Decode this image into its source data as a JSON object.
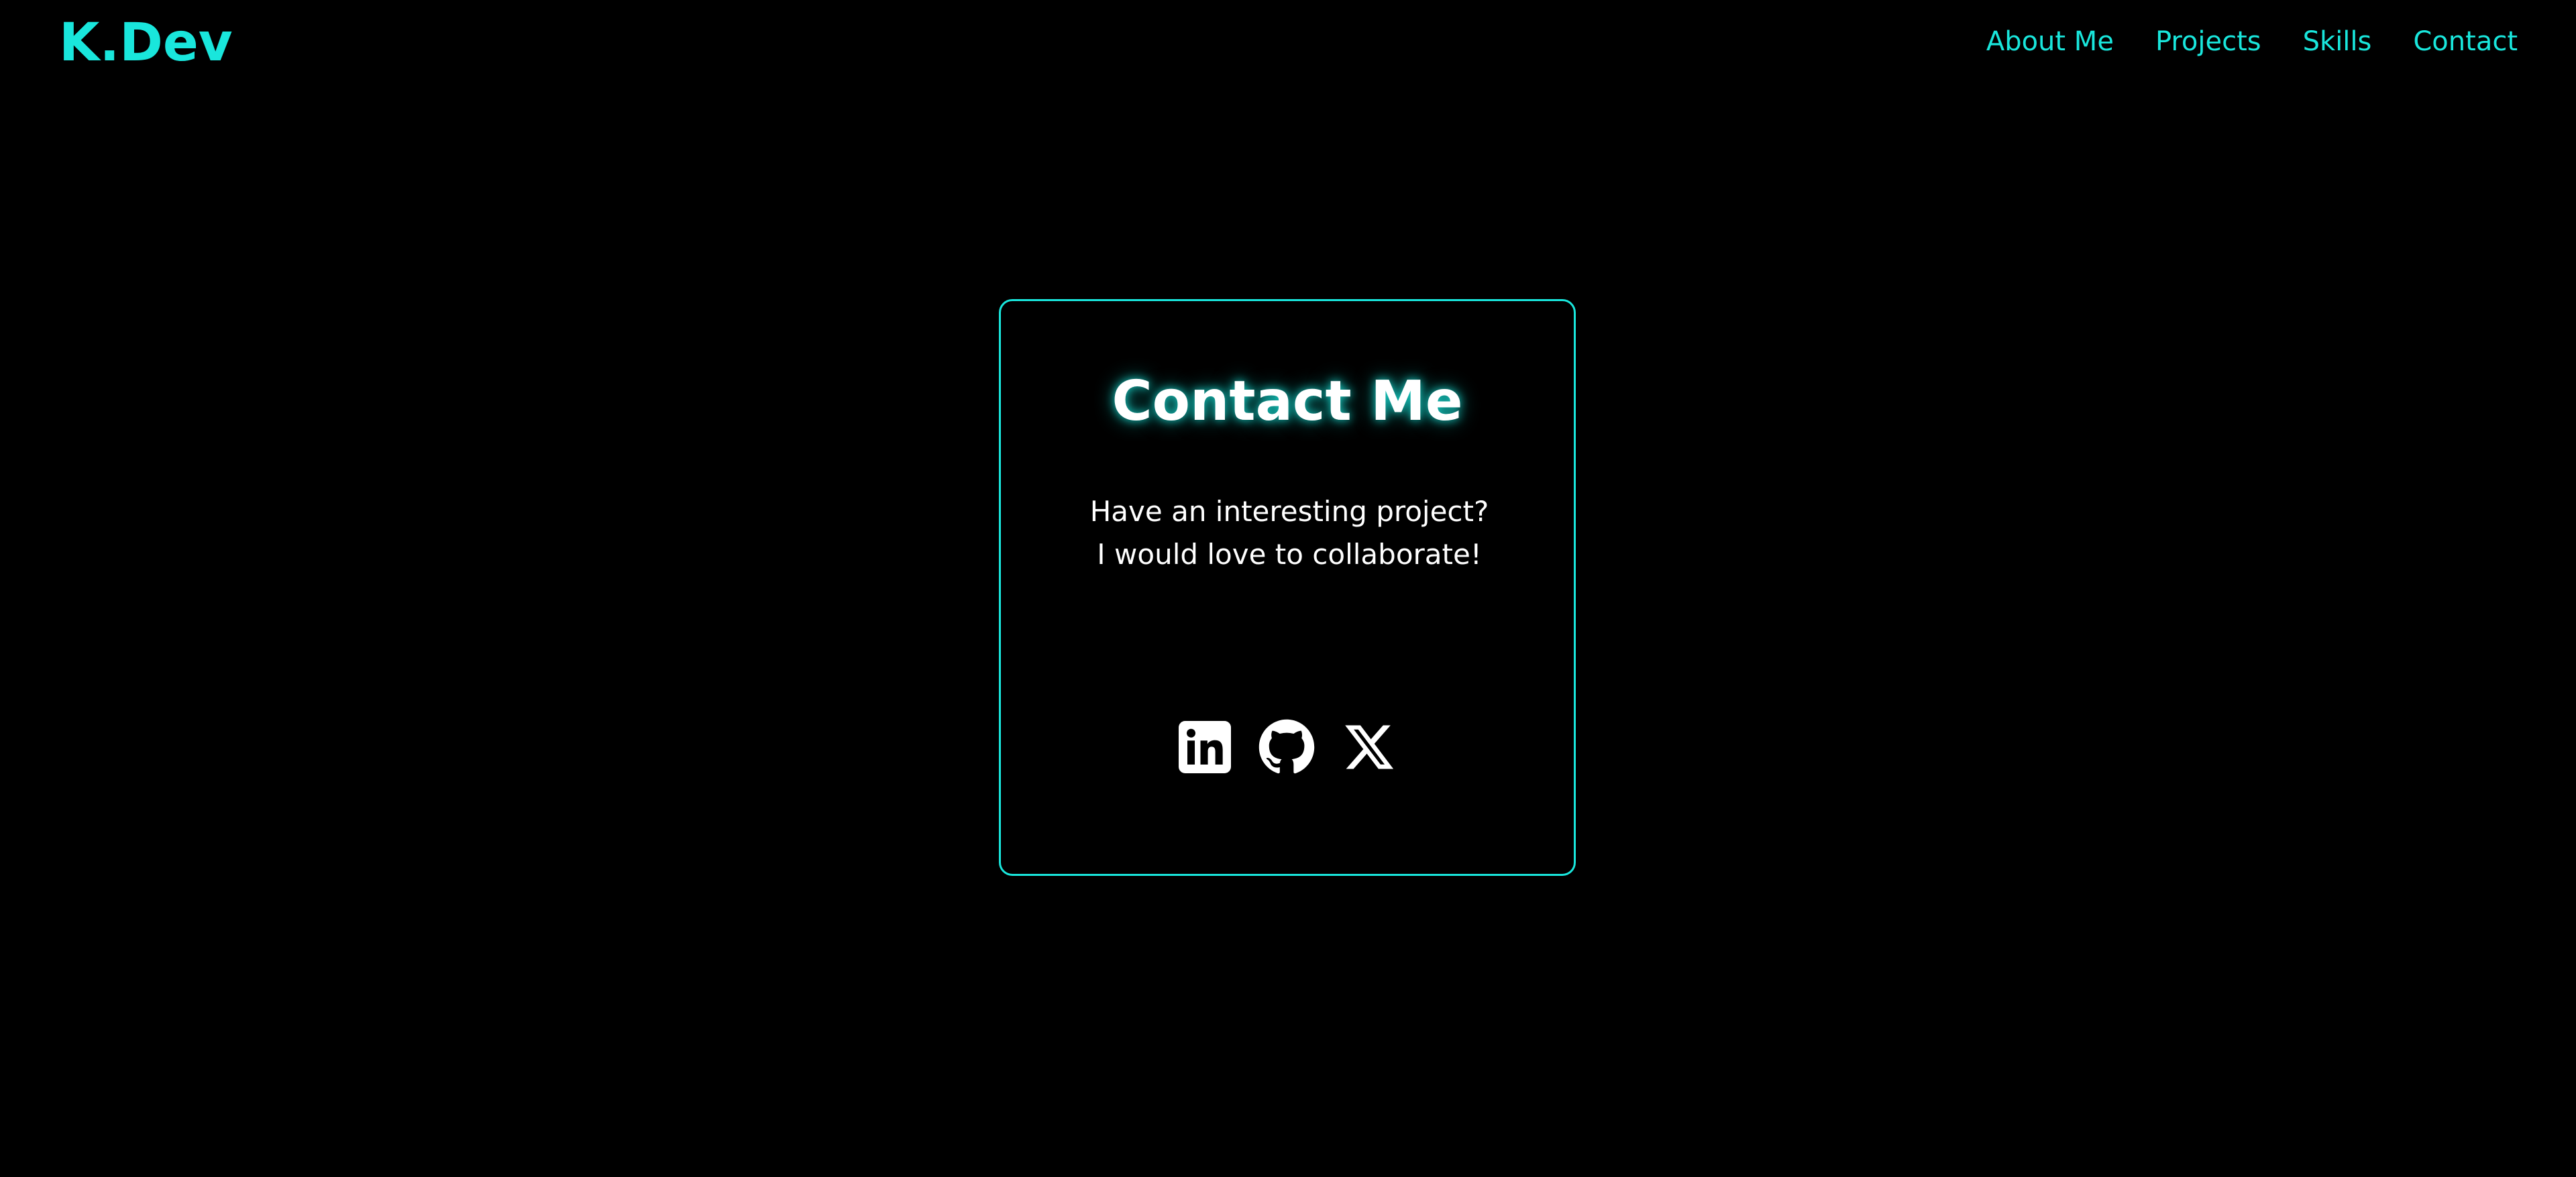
{
  "header": {
    "logo": "K.Dev",
    "nav": [
      {
        "label": "About Me"
      },
      {
        "label": "Projects"
      },
      {
        "label": "Skills"
      },
      {
        "label": "Contact"
      }
    ]
  },
  "contact": {
    "title": "Contact Me",
    "text": "Have an interesting project? I would love to collaborate!",
    "socials": [
      {
        "icon": "linkedin-icon"
      },
      {
        "icon": "github-icon"
      },
      {
        "icon": "x-icon"
      }
    ]
  },
  "colors": {
    "accent": "#19e6dc",
    "background": "#000000",
    "text": "#ffffff"
  }
}
